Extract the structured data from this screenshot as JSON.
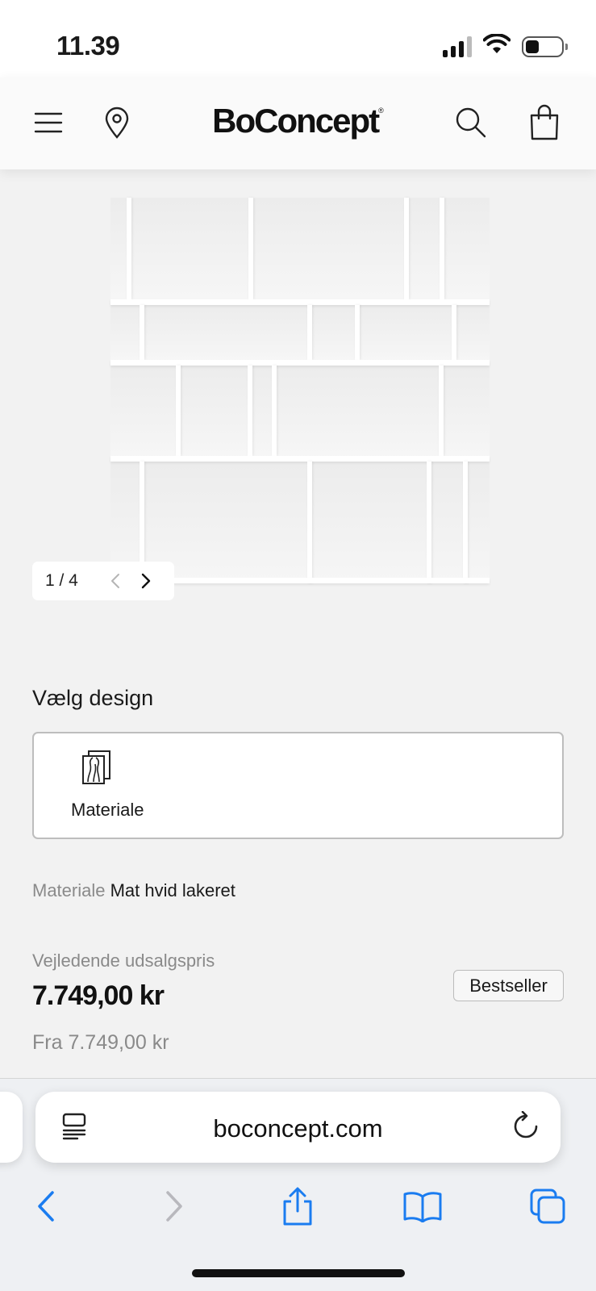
{
  "status_bar": {
    "time": "11.39",
    "icons": [
      "signal-icon",
      "wifi-icon",
      "battery-icon"
    ]
  },
  "header": {
    "logo": "BoConcept",
    "logo_mark": "®",
    "icons": [
      "menu-icon",
      "location-pin-icon",
      "search-icon",
      "shopping-bag-icon"
    ]
  },
  "gallery": {
    "counter": "1 / 4",
    "current": 1,
    "total": 4
  },
  "design": {
    "title": "Vælg design",
    "options": [
      {
        "label": "Materiale",
        "icon": "material-swatch-icon"
      }
    ]
  },
  "material": {
    "key": "Materiale",
    "value": "Mat hvid lakeret"
  },
  "pricing": {
    "label": "Vejledende udsalgspris",
    "price": "7.749,00 kr",
    "from": "Fra 7.749,00 kr",
    "badge": "Bestseller"
  },
  "browser": {
    "url": "boconcept.com",
    "accent": "#1a7cf0",
    "toolbar": [
      "back-icon",
      "forward-icon",
      "share-icon",
      "bookmarks-icon",
      "tabs-icon"
    ]
  }
}
